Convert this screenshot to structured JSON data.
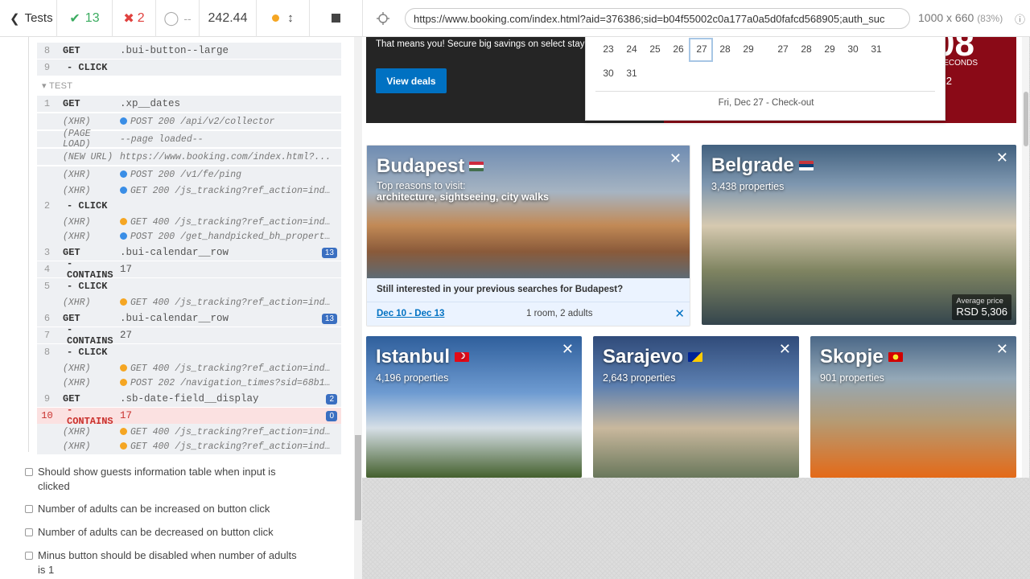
{
  "topbar": {
    "tests_label": "Tests",
    "passed": "13",
    "failed": "2",
    "pending": "--",
    "duration": "242.44",
    "url": "https://www.booking.com/index.html?aid=376386;sid=b04f55002c0a177a0a5d0fafcd568905;auth_suc",
    "viewport": "1000 x 660",
    "zoom": "(83%)"
  },
  "log": {
    "r0": {
      "n": "8",
      "m": "GET",
      "msg": ".bui-button--large"
    },
    "r1": {
      "n": "9",
      "m": "- CLICK",
      "msg": ""
    },
    "test_label": "TEST",
    "r2": {
      "n": "1",
      "m": "GET",
      "msg": ".xp__dates"
    },
    "r3": {
      "m": "(XHR)",
      "msg": "POST 200 /api/v2/collector"
    },
    "r4": {
      "m": "(PAGE LOAD)",
      "msg": "--page loaded--"
    },
    "r5": {
      "m": "(NEW URL)",
      "msg": "https://www.booking.com/index.html?..."
    },
    "r6": {
      "m": "(XHR)",
      "msg": "POST 200 /v1/fe/ping"
    },
    "r7": {
      "m": "(XHR)",
      "msg": "GET 200 /js_tracking?ref_action=index&l..."
    },
    "r8": {
      "n": "2",
      "m": "- CLICK",
      "msg": ""
    },
    "r9": {
      "m": "(XHR)",
      "msg": "GET 400 /js_tracking?ref_action=index&l..."
    },
    "r10": {
      "m": "(XHR)",
      "msg": "POST 200 /get_handpicked_bh_properties?..."
    },
    "r11": {
      "n": "3",
      "m": "GET",
      "msg": ".bui-calendar__row",
      "badge": "13"
    },
    "r12": {
      "n": "4",
      "m": "- CONTAINS",
      "msg": "17"
    },
    "r13": {
      "n": "5",
      "m": "- CLICK",
      "msg": ""
    },
    "r14": {
      "m": "(XHR)",
      "msg": "GET 400 /js_tracking?ref_action=index&l..."
    },
    "r15": {
      "n": "6",
      "m": "GET",
      "msg": ".bui-calendar__row",
      "badge": "13"
    },
    "r16": {
      "n": "7",
      "m": "- CONTAINS",
      "msg": "27"
    },
    "r17": {
      "n": "8",
      "m": "- CLICK",
      "msg": ""
    },
    "r18": {
      "m": "(XHR)",
      "msg": "GET 400 /js_tracking?ref_action=index&l..."
    },
    "r19": {
      "m": "(XHR)",
      "msg": "POST 202 /navigation_times?sid=68b1a662..."
    },
    "r20": {
      "n": "9",
      "m": "GET",
      "msg": ".sb-date-field__display",
      "badge": "2"
    },
    "r21": {
      "n": "10",
      "m": "- CONTAINS",
      "msg": "17",
      "badge": "0"
    },
    "r22": {
      "m": "(XHR)",
      "msg": "GET 400 /js_tracking?ref_action=index&l..."
    },
    "r23": {
      "m": "(XHR)",
      "msg": "GET 400 /js_tracking?ref_action=index&l..."
    }
  },
  "tests": [
    "Should show guests information table when input is clicked",
    "Number of adults can be increased on button click",
    "Number of adults can be decreased on button click",
    "Minus button should be disabled when number of adults is 1"
  ],
  "site": {
    "promo_text": "That means you! Secure big savings on select stay",
    "view_deals": "View deals",
    "promo_seconds": "ECONDS",
    "promo_x2": "r 2",
    "promo_big": "08",
    "calendar": {
      "days": [
        "23",
        "24",
        "25",
        "26",
        "27",
        "28",
        "29",
        "27",
        "28",
        "29",
        "30",
        "31",
        "30",
        "31"
      ],
      "footer": "Fri, Dec 27 - Check-out"
    },
    "budapest": {
      "city": "Budapest",
      "reasons": "Top reasons to visit:",
      "reasons_list": "architecture, sightseeing, city walks",
      "question": "Still interested in your previous searches for Budapest?",
      "dates": "Dec 10 - Dec 13",
      "room": "1 room, 2 adults"
    },
    "belgrade": {
      "city": "Belgrade",
      "props": "3,438 properties",
      "avg_label": "Average price",
      "avg_value": "RSD 5,306"
    },
    "istanbul": {
      "city": "Istanbul",
      "props": "4,196 properties"
    },
    "sarajevo": {
      "city": "Sarajevo",
      "props": "2,643 properties"
    },
    "skopje": {
      "city": "Skopje",
      "props": "901 properties"
    }
  },
  "colors": {
    "pass": "#3bac60",
    "fail": "#e0413e",
    "xhr_ok": "#3a8ee6",
    "xhr_err": "#f5a623",
    "badge": "#3a6fc1",
    "booking_blue": "#0071c2"
  }
}
